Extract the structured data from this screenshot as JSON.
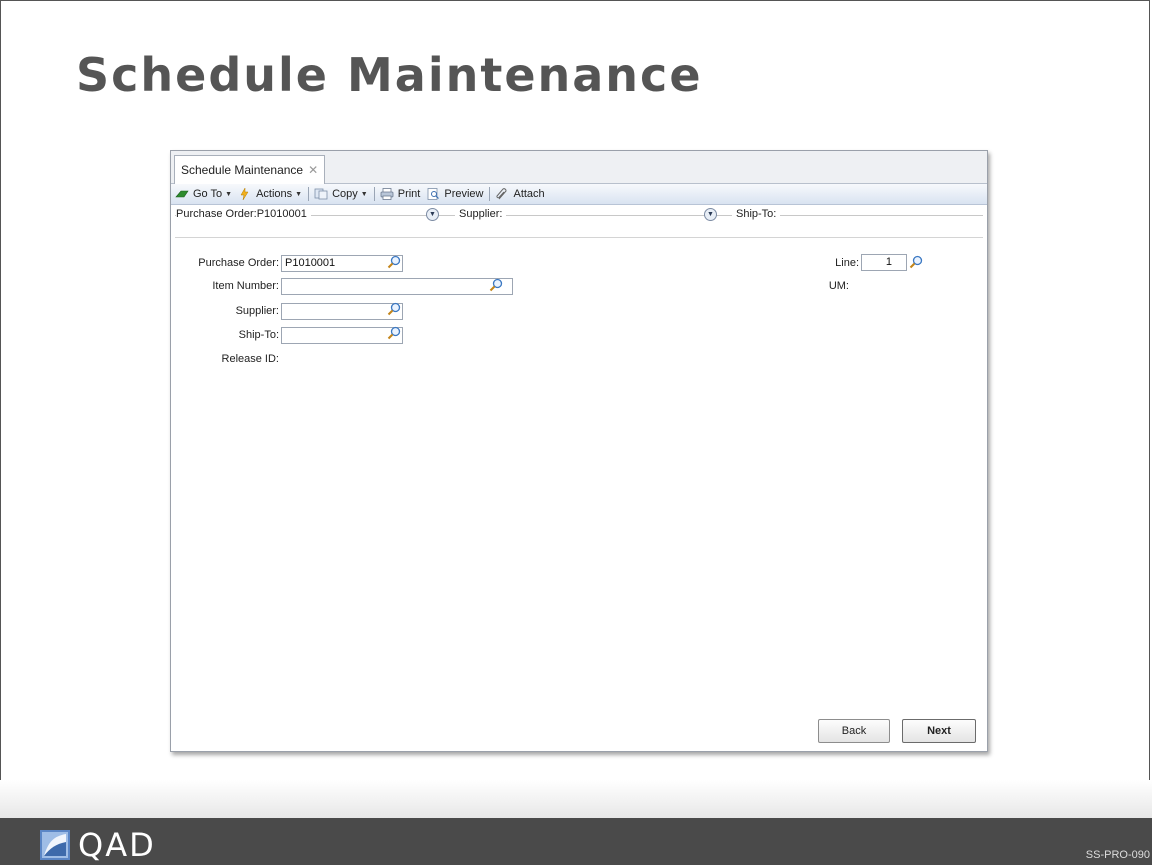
{
  "slide": {
    "title": "Schedule Maintenance",
    "logo_text": "QAD",
    "doc_code": "SS-PRO-090"
  },
  "window": {
    "tab_label": "Schedule Maintenance",
    "tab_close": "✕"
  },
  "toolbar": {
    "goto": "Go To",
    "actions": "Actions",
    "copy": "Copy",
    "print": "Print",
    "preview": "Preview",
    "attach": "Attach"
  },
  "header": {
    "purchase_order": "Purchase Order:P1010001",
    "supplier": "Supplier:",
    "ship_to": "Ship-To:"
  },
  "form": {
    "purchase_order_label": "Purchase Order:",
    "purchase_order_value": "P1010001",
    "item_number_label": "Item Number:",
    "item_number_value": "",
    "supplier_label": "Supplier:",
    "supplier_value": "",
    "ship_to_label": "Ship-To:",
    "ship_to_value": "",
    "release_id_label": "Release ID:",
    "line_label": "Line:",
    "line_value": "1",
    "um_label": "UM:"
  },
  "buttons": {
    "back": "Back",
    "next": "Next"
  },
  "icons": {
    "lookup": "magnifier-icon",
    "expand": "expand-circle-icon"
  }
}
